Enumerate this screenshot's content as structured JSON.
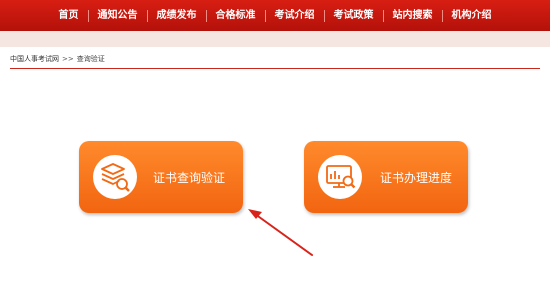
{
  "nav": {
    "items": [
      "首页",
      "通知公告",
      "成绩发布",
      "合格标准",
      "考试介绍",
      "考试政策",
      "站内搜索",
      "机构介绍"
    ]
  },
  "breadcrumb": {
    "home": "中国人事考试网",
    "separator": ">>",
    "current": "查询验证"
  },
  "tiles": {
    "certificate_verify": {
      "label": "证书查询验证",
      "icon": "layers-magnifier-icon"
    },
    "certificate_progress": {
      "label": "证书办理进度",
      "icon": "monitor-chart-magnifier-icon"
    }
  },
  "colors": {
    "nav_red": "#c8170e",
    "tile_orange": "#f7781e",
    "annotation_arrow": "#d9231a"
  }
}
